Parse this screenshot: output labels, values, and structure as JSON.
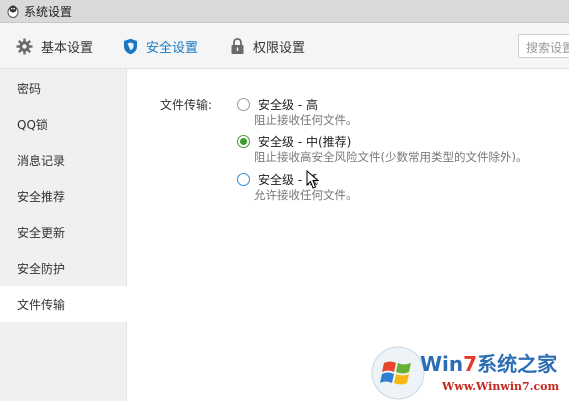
{
  "window": {
    "title": "系统设置"
  },
  "top_nav": {
    "tabs": [
      {
        "label": "基本设置",
        "icon": "gear-icon",
        "active": false
      },
      {
        "label": "安全设置",
        "icon": "shield-icon",
        "active": true
      },
      {
        "label": "权限设置",
        "icon": "lock-icon",
        "active": false
      }
    ],
    "search_placeholder": "搜索设置"
  },
  "sidebar": {
    "items": [
      {
        "label": "密码",
        "active": false
      },
      {
        "label": "QQ锁",
        "active": false
      },
      {
        "label": "消息记录",
        "active": false
      },
      {
        "label": "安全推荐",
        "active": false
      },
      {
        "label": "安全更新",
        "active": false
      },
      {
        "label": "安全防护",
        "active": false
      },
      {
        "label": "文件传输",
        "active": true
      }
    ]
  },
  "file_transfer": {
    "label": "文件传输:",
    "options": [
      {
        "label": "安全级 - 高",
        "description": "阻止接收任何文件。",
        "checked": false
      },
      {
        "label": "安全级 - 中(推荐)",
        "description": "阻止接收高安全风险文件(少数常用类型的文件除外)。",
        "checked": true
      },
      {
        "label": "安全级 - 低",
        "description": "允许接收任何文件。",
        "checked": false
      }
    ]
  },
  "watermark": {
    "brand_prefix": "Win",
    "brand_seven": "7",
    "brand_suffix": "系统之家",
    "url": "Www.Winwin7.com"
  },
  "colors": {
    "accent_blue": "#1a78c2",
    "radio_green": "#3f9a2f",
    "sidebar_bg": "#f0f0f0"
  }
}
